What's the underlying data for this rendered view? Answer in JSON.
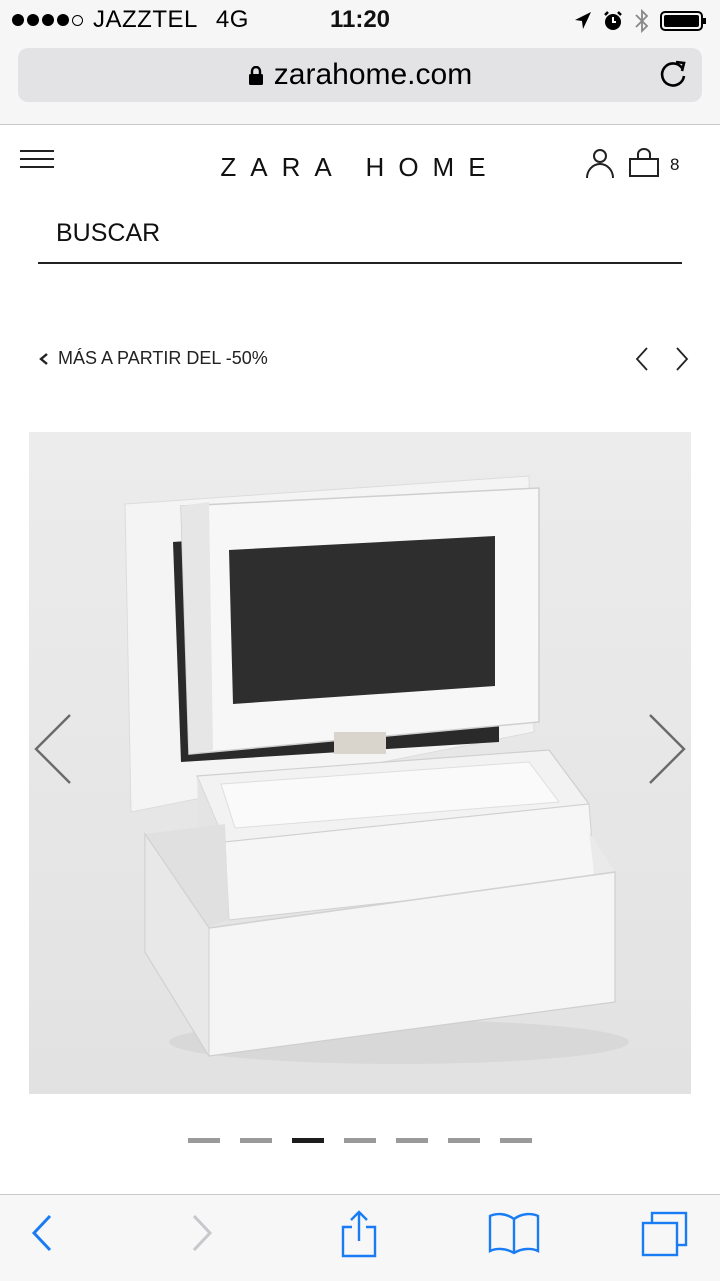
{
  "status_bar": {
    "carrier": "JAZZTEL",
    "network": "4G",
    "time": "11:20"
  },
  "browser": {
    "url": "zarahome.com"
  },
  "header": {
    "logo": "ZARA HOME",
    "bag_count": "8"
  },
  "search": {
    "placeholder": "BUSCAR"
  },
  "breadcrumb": {
    "label": "MÁS A PARTIR DEL -50%"
  },
  "gallery": {
    "total_images": 7,
    "active_index": 2
  },
  "colors": {
    "accent": "#1a7cf5",
    "text": "#111111",
    "bar_bg": "#f6f6f6"
  }
}
